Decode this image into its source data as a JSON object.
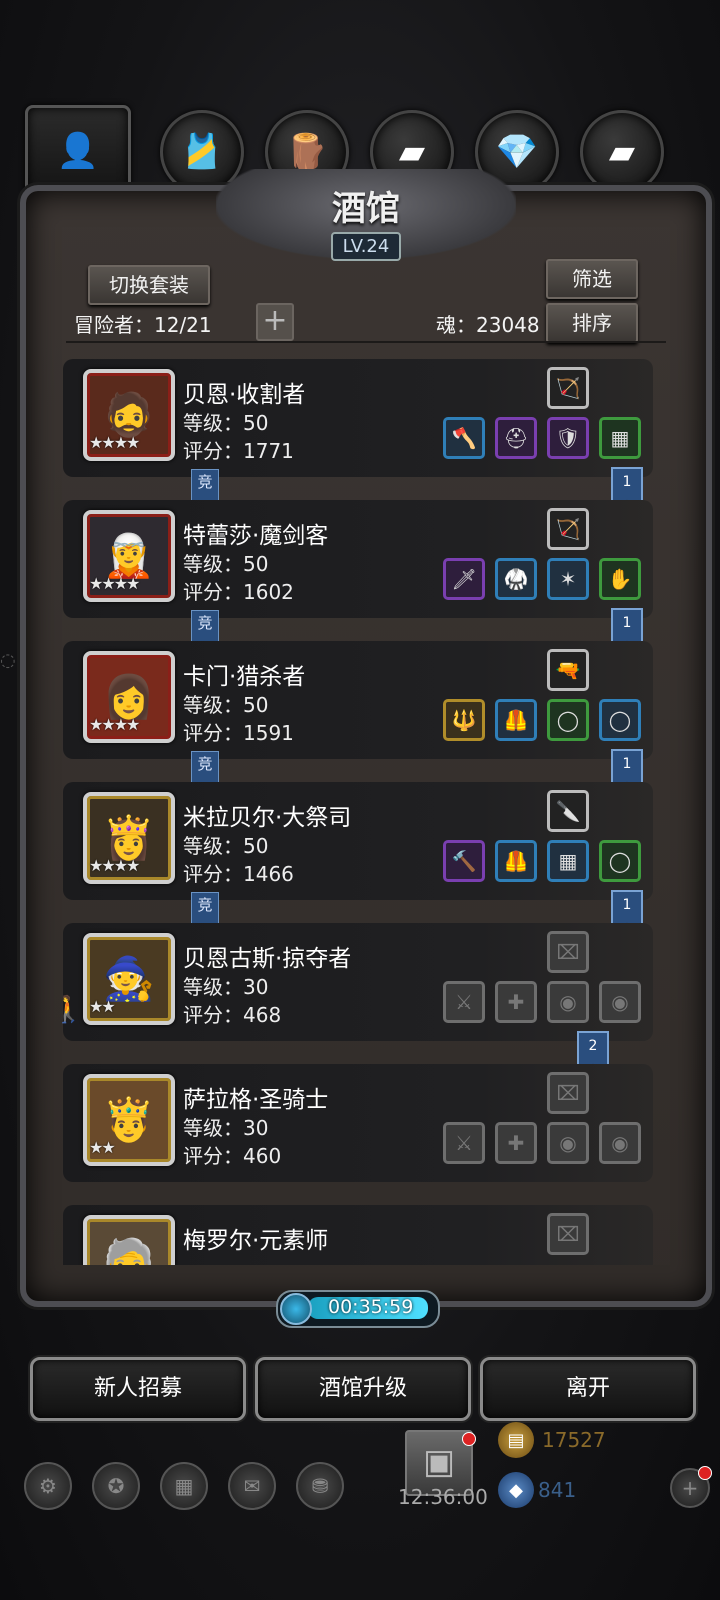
{
  "tabs": [
    {
      "icon": "hooded-figure-icon",
      "glyph": "👤"
    },
    {
      "icon": "leather-armor-icon",
      "glyph": "🎽"
    },
    {
      "icon": "wood-plank-icon",
      "glyph": "🪵"
    },
    {
      "icon": "iron-ingot-icon",
      "glyph": "▰"
    },
    {
      "icon": "blue-crystal-icon",
      "glyph": "💎"
    },
    {
      "icon": "black-ore-icon",
      "glyph": "▰"
    }
  ],
  "header": {
    "title": "酒馆",
    "level": "LV.24",
    "switch_set_label": "切换套装",
    "filter_label": "筛选",
    "sort_label": "排序",
    "adventurers_label": "冒险者：12/21",
    "plus_glyph": "+",
    "soul_label": "魂：23048"
  },
  "heroes": [
    {
      "name": "贝恩·收割者",
      "level": "等级：50",
      "score": "评分：1771",
      "stars": "★★★★",
      "portrait": "🧔",
      "frame": "red",
      "badge": "竞",
      "bookmark": "1",
      "weapon": {
        "glyph": "🏹",
        "style": "gray"
      },
      "gear": [
        {
          "glyph": "🪓",
          "style": "blue"
        },
        {
          "glyph": "⛑",
          "style": "purple"
        },
        {
          "glyph": "🛡",
          "style": "purple"
        },
        {
          "glyph": "▦",
          "style": "green"
        }
      ]
    },
    {
      "name": "特蕾莎·魔剑客",
      "level": "等级：50",
      "score": "评分：1602",
      "stars": "★★★★",
      "portrait": "🧝",
      "frame": "red",
      "badge": "竞",
      "bookmark": "1",
      "weapon": {
        "glyph": "🏹",
        "style": "gray"
      },
      "gear": [
        {
          "glyph": "🗡",
          "style": "purple"
        },
        {
          "glyph": "🥋",
          "style": "blue"
        },
        {
          "glyph": "✶",
          "style": "blue"
        },
        {
          "glyph": "✋",
          "style": "green"
        }
      ]
    },
    {
      "name": "卡门·猎杀者",
      "level": "等级：50",
      "score": "评分：1591",
      "stars": "★★★★",
      "portrait": "👩",
      "frame": "red",
      "badge": "竞",
      "bookmark": "1",
      "weapon": {
        "glyph": "🔫",
        "style": "gray"
      },
      "gear": [
        {
          "glyph": "🔱",
          "style": "gold"
        },
        {
          "glyph": "🦺",
          "style": "blue"
        },
        {
          "glyph": "◯",
          "style": "green"
        },
        {
          "glyph": "◯",
          "style": "blue"
        }
      ]
    },
    {
      "name": "米拉贝尔·大祭司",
      "level": "等级：50",
      "score": "评分：1466",
      "stars": "★★★★",
      "portrait": "👸",
      "frame": "gold",
      "badge": "竞",
      "bookmark": "1",
      "weapon": {
        "glyph": "🔪",
        "style": "gray"
      },
      "gear": [
        {
          "glyph": "🔨",
          "style": "purple"
        },
        {
          "glyph": "🦺",
          "style": "blue"
        },
        {
          "glyph": "▦",
          "style": "blue"
        },
        {
          "glyph": "◯",
          "style": "green"
        }
      ]
    },
    {
      "name": "贝恩古斯·掠夺者",
      "level": "等级：30",
      "score": "评分：468",
      "stars": "★★",
      "portrait": "🧙",
      "frame": "gold",
      "badge": "",
      "bookmark": "2",
      "weapon": {
        "glyph": "⌧",
        "style": "empty"
      },
      "gear": [
        {
          "glyph": "⚔",
          "style": "empty"
        },
        {
          "glyph": "✚",
          "style": "empty"
        },
        {
          "glyph": "◉",
          "style": "empty"
        },
        {
          "glyph": "◉",
          "style": "empty"
        }
      ]
    },
    {
      "name": "萨拉格·圣骑士",
      "level": "等级：30",
      "score": "评分：460",
      "stars": "★★",
      "portrait": "🤴",
      "frame": "gold",
      "badge": "",
      "bookmark": "",
      "weapon": {
        "glyph": "⌧",
        "style": "empty"
      },
      "gear": [
        {
          "glyph": "⚔",
          "style": "empty"
        },
        {
          "glyph": "✚",
          "style": "empty"
        },
        {
          "glyph": "◉",
          "style": "empty"
        },
        {
          "glyph": "◉",
          "style": "empty"
        }
      ]
    },
    {
      "name": "梅罗尔·元素师",
      "level": "",
      "score": "",
      "stars": "",
      "portrait": "🧓",
      "frame": "gold",
      "badge": "",
      "bookmark": "",
      "weapon": {
        "glyph": "⌧",
        "style": "empty"
      },
      "gear": []
    }
  ],
  "timer": {
    "value": "00:35:59"
  },
  "actions": {
    "recruit_label": "新人招募",
    "upgrade_label": "酒馆升级",
    "leave_label": "离开"
  },
  "hud": {
    "clock": "12:36:00",
    "gold": "17527",
    "gems": "841"
  },
  "colors": {
    "accent_blue": "#2a4e7e",
    "panel": "#3b3532",
    "gold_text": "#8a6a2a",
    "gem_text": "#3a5f8a"
  }
}
